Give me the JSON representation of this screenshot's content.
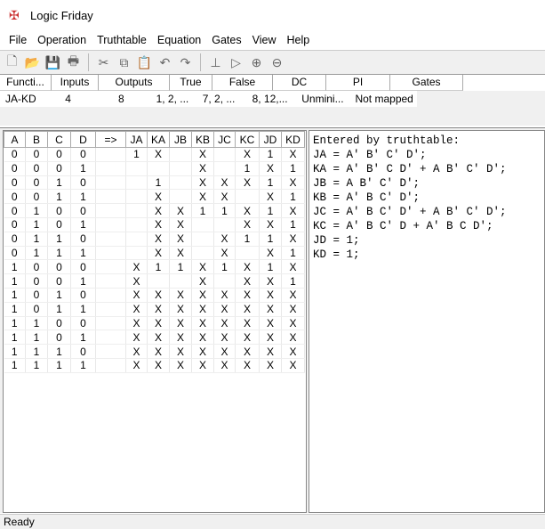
{
  "window": {
    "title": "Logic Friday",
    "icon": "logic-friday-icon"
  },
  "menu": [
    "File",
    "Operation",
    "Truthtable",
    "Equation",
    "Gates",
    "View",
    "Help"
  ],
  "toolbar": [
    "new-icon",
    "open-icon",
    "save-icon",
    "print-icon",
    "|",
    "cut-icon",
    "copy-icon",
    "paste-icon",
    "undo-icon",
    "redo-icon",
    "|",
    "minimize-icon",
    "gate-icon",
    "zoom-in-icon",
    "zoom-out-icon"
  ],
  "function_list": {
    "columns": [
      "Functi...",
      "Inputs",
      "Outputs",
      "True",
      "False",
      "DC",
      "PI",
      "Gates"
    ],
    "rows": [
      [
        "JA-KD",
        "4",
        "8",
        "1, 2, ...",
        "7, 2, ...",
        "8, 12,...",
        "Unmini...",
        "Not mapped"
      ]
    ]
  },
  "truthtable": {
    "columns": [
      "A",
      "B",
      "C",
      "D",
      "=>",
      "JA",
      "KA",
      "JB",
      "KB",
      "JC",
      "KC",
      "JD",
      "KD"
    ],
    "rows": [
      [
        "0",
        "0",
        "0",
        "0",
        "",
        "1",
        "X",
        "",
        "X",
        "",
        "X",
        "1",
        "X"
      ],
      [
        "0",
        "0",
        "0",
        "1",
        "",
        "",
        "",
        "",
        "X",
        "",
        "1",
        "X",
        "1"
      ],
      [
        "0",
        "0",
        "1",
        "0",
        "",
        "",
        "1",
        "",
        "X",
        "X",
        "X",
        "1",
        "X"
      ],
      [
        "0",
        "0",
        "1",
        "1",
        "",
        "",
        "X",
        "",
        "X",
        "X",
        "",
        "X",
        "1"
      ],
      [
        "0",
        "1",
        "0",
        "0",
        "",
        "",
        "X",
        "X",
        "1",
        "1",
        "X",
        "1",
        "X"
      ],
      [
        "0",
        "1",
        "0",
        "1",
        "",
        "",
        "X",
        "X",
        "",
        "",
        "X",
        "X",
        "1"
      ],
      [
        "0",
        "1",
        "1",
        "0",
        "",
        "",
        "X",
        "X",
        "",
        "X",
        "1",
        "1",
        "X"
      ],
      [
        "0",
        "1",
        "1",
        "1",
        "",
        "",
        "X",
        "X",
        "",
        "X",
        "",
        "X",
        "1"
      ],
      [
        "1",
        "0",
        "0",
        "0",
        "",
        "X",
        "1",
        "1",
        "X",
        "1",
        "X",
        "1",
        "X"
      ],
      [
        "1",
        "0",
        "0",
        "1",
        "",
        "X",
        "",
        "",
        "X",
        "",
        "X",
        "X",
        "1"
      ],
      [
        "1",
        "0",
        "1",
        "0",
        "",
        "X",
        "X",
        "X",
        "X",
        "X",
        "X",
        "X",
        "X"
      ],
      [
        "1",
        "0",
        "1",
        "1",
        "",
        "X",
        "X",
        "X",
        "X",
        "X",
        "X",
        "X",
        "X"
      ],
      [
        "1",
        "1",
        "0",
        "0",
        "",
        "X",
        "X",
        "X",
        "X",
        "X",
        "X",
        "X",
        "X"
      ],
      [
        "1",
        "1",
        "0",
        "1",
        "",
        "X",
        "X",
        "X",
        "X",
        "X",
        "X",
        "X",
        "X"
      ],
      [
        "1",
        "1",
        "1",
        "0",
        "",
        "X",
        "X",
        "X",
        "X",
        "X",
        "X",
        "X",
        "X"
      ],
      [
        "1",
        "1",
        "1",
        "1",
        "",
        "X",
        "X",
        "X",
        "X",
        "X",
        "X",
        "X",
        "X"
      ]
    ]
  },
  "equations": [
    "Entered by truthtable:",
    "JA = A' B' C' D';",
    "KA = A' B' C D' + A B' C' D';",
    "JB = A B' C' D';",
    "KB = A' B C' D';",
    "JC = A' B C' D' + A B' C' D';",
    "KC = A' B C' D + A' B C D';",
    "JD = 1;",
    "KD = 1;"
  ],
  "status": "Ready"
}
